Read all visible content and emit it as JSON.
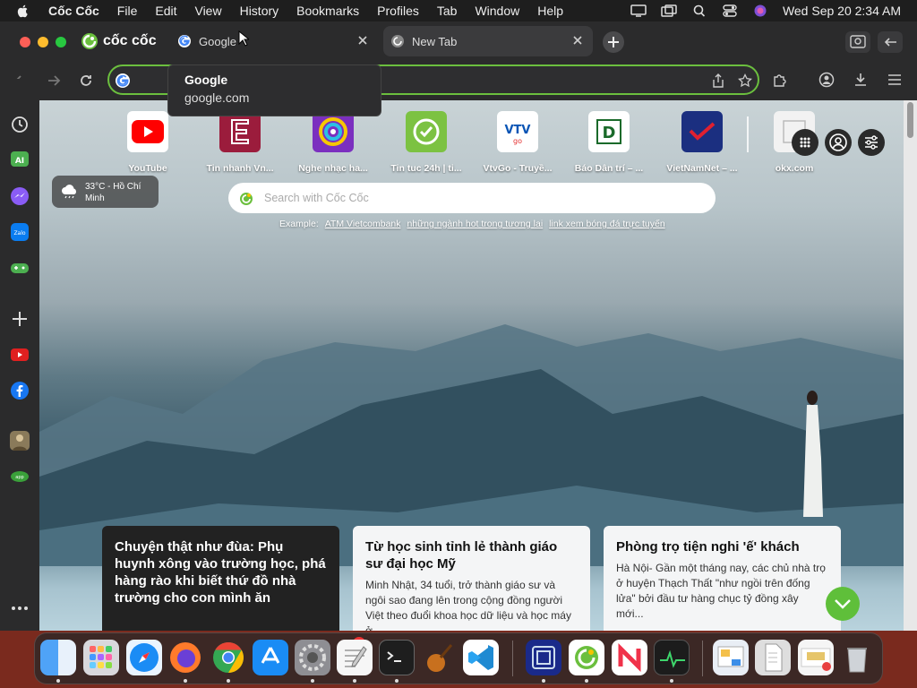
{
  "menubar": {
    "app_name": "Cốc Cốc",
    "items": [
      "File",
      "Edit",
      "View",
      "History",
      "Bookmarks",
      "Profiles",
      "Tab",
      "Window",
      "Help"
    ],
    "datetime": "Wed Sep 20  2:34 AM",
    "icons": [
      "display-icon",
      "window-icon",
      "search-icon",
      "control-center-icon",
      "siri-icon"
    ]
  },
  "browser": {
    "brand": "cốc cốc",
    "tabs": [
      {
        "title": "Google",
        "active": true
      },
      {
        "title": "New Tab",
        "active": false
      }
    ],
    "tooltip": {
      "title": "Google",
      "url": "google.com"
    }
  },
  "sidebar": {
    "items": [
      "history-icon",
      "ai-chat-icon",
      "messenger-icon",
      "zalo-icon",
      "game-icon",
      "add-icon",
      "youtube-icon",
      "facebook-icon",
      "avatar-icon",
      "app-icon",
      "more-icon"
    ]
  },
  "newtab": {
    "shortcuts": [
      {
        "label": "YouTube"
      },
      {
        "label": "Tin nhanh Vn..."
      },
      {
        "label": "Nghe nhạc ha..."
      },
      {
        "label": "Tin tuc 24h | ti..."
      },
      {
        "label": "VtvGo - Truyề..."
      },
      {
        "label": "Báo Dân trí – ..."
      },
      {
        "label": "VietNamNet – ..."
      },
      {
        "label": "okx.com"
      }
    ],
    "weather": {
      "line1": "33°C - Hồ Chí",
      "line2": "Minh"
    },
    "search_placeholder": "Search with Cốc Cốc",
    "example_prefix": "Example:",
    "example_links": [
      "ATM Vietcombank",
      "những ngành hot trong tương lai",
      "link xem bóng đá trực tuyến"
    ],
    "news": [
      {
        "headline": "Chuyện thật như đùa: Phụ huynh xông vào trường học, phá hàng rào khi biết thứ đồ nhà trường cho con mình ăn",
        "summary": ""
      },
      {
        "headline": "Từ học sinh tỉnh lẻ thành giáo sư đại học Mỹ",
        "summary": "Minh Nhật, 34 tuổi, trở thành giáo sư và ngôi sao đang lên trong cộng đồng người Việt theo đuổi khoa học dữ liệu và học máy ở..."
      },
      {
        "headline": "Phòng trọ tiện nghi 'ế' khách",
        "summary": "Hà Nội- Gần một tháng nay, các chủ nhà trọ ở huyện Thạch Thất \"như ngồi trên đống lửa\" bởi đầu tư hàng chục tỷ đồng xây mới..."
      }
    ]
  },
  "dock": {
    "apps": [
      "finder-icon",
      "launchpad-icon",
      "safari-icon",
      "firefox-icon",
      "chrome-icon",
      "app-store-icon",
      "system-settings-icon",
      "textedit-icon",
      "terminal-icon",
      "garageband-icon",
      "vscode-icon",
      "qemu-icon",
      "coccoc-icon",
      "news-icon",
      "activity-monitor-icon",
      "preview-icon",
      "document-icon",
      "error-page-icon",
      "trash-icon"
    ],
    "settings_badge": "2"
  },
  "colors": {
    "accent": "#6bbf3e",
    "menubar": "#1e1e1e",
    "window": "#2b2b2c"
  }
}
